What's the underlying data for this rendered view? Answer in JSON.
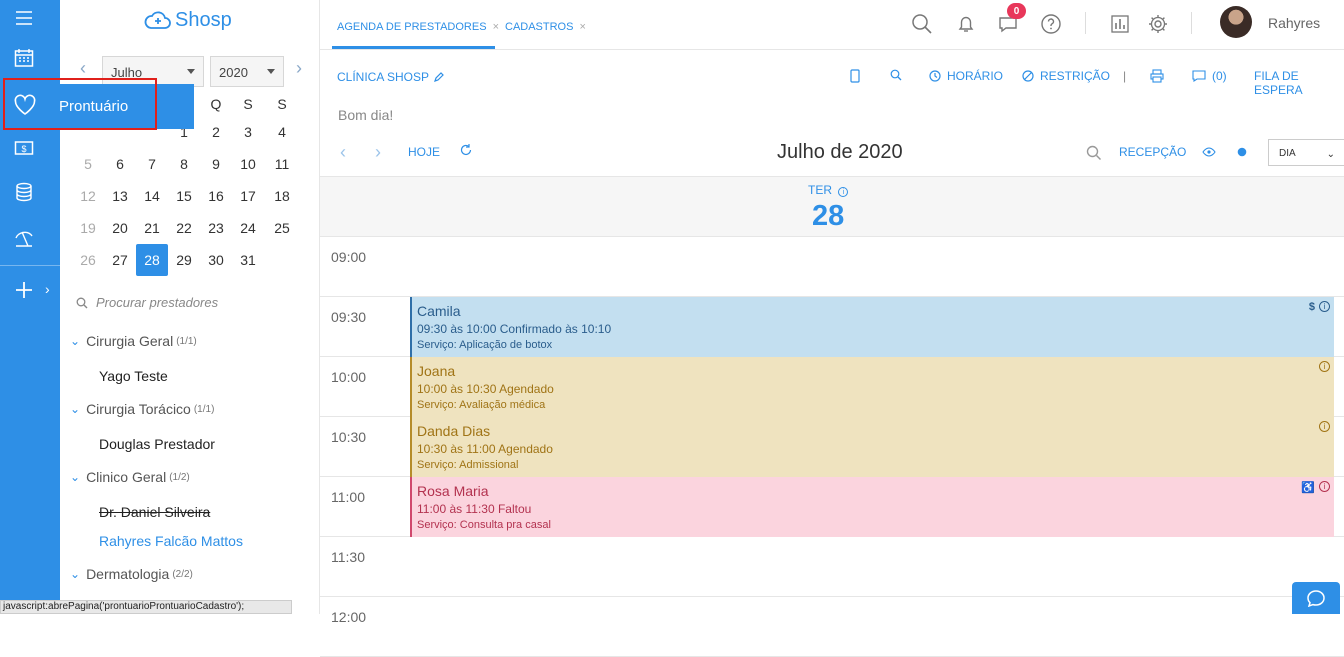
{
  "app": {
    "logo_text": "Shosp"
  },
  "tooltip": {
    "label": "Prontuário"
  },
  "calendar": {
    "month": "Julho",
    "year": "2020",
    "weekday_headers": [
      "Q",
      "S",
      "S"
    ],
    "rows": [
      [
        {
          "d": "1",
          "m": false
        },
        {
          "d": "2",
          "m": false
        },
        {
          "d": "3",
          "m": false
        },
        {
          "d": "4",
          "m": false
        }
      ],
      [
        {
          "d": "5",
          "m": true
        },
        {
          "d": "6",
          "m": false
        },
        {
          "d": "7",
          "m": false
        },
        {
          "d": "8",
          "m": false
        },
        {
          "d": "9",
          "m": false
        },
        {
          "d": "10",
          "m": false
        },
        {
          "d": "11",
          "m": false
        }
      ],
      [
        {
          "d": "12",
          "m": true
        },
        {
          "d": "13",
          "m": false
        },
        {
          "d": "14",
          "m": false
        },
        {
          "d": "15",
          "m": false
        },
        {
          "d": "16",
          "m": false
        },
        {
          "d": "17",
          "m": false
        },
        {
          "d": "18",
          "m": false
        }
      ],
      [
        {
          "d": "19",
          "m": true
        },
        {
          "d": "20",
          "m": false
        },
        {
          "d": "21",
          "m": false
        },
        {
          "d": "22",
          "m": false
        },
        {
          "d": "23",
          "m": false
        },
        {
          "d": "24",
          "m": false
        },
        {
          "d": "25",
          "m": false
        }
      ],
      [
        {
          "d": "26",
          "m": true
        },
        {
          "d": "27",
          "m": false
        },
        {
          "d": "28",
          "m": false,
          "sel": true
        },
        {
          "d": "29",
          "m": false
        },
        {
          "d": "30",
          "m": false
        },
        {
          "d": "31",
          "m": false
        }
      ]
    ]
  },
  "search_prestadores": {
    "placeholder": "Procurar prestadores"
  },
  "groups": [
    {
      "name": "Cirurgia Geral",
      "count": "(1/1)",
      "prestadores": [
        {
          "name": "Yago Teste",
          "style": "normal"
        }
      ]
    },
    {
      "name": "Cirurgia Torácico",
      "count": "(1/1)",
      "prestadores": [
        {
          "name": "Douglas Prestador",
          "style": "normal"
        }
      ]
    },
    {
      "name": "Clinico Geral",
      "count": "(1/2)",
      "prestadores": [
        {
          "name": "Dr. Daniel Silveira",
          "style": "strike"
        },
        {
          "name": "Rahyres Falcão Mattos",
          "style": "link"
        }
      ]
    },
    {
      "name": "Dermatologia",
      "count": "(2/2)",
      "prestadores": []
    }
  ],
  "status_bar": {
    "text": "javascript:abrePagina('prontuarioProntuarioCadastro');"
  },
  "tabs": [
    {
      "label": "AGENDA DE PRESTADORES",
      "active": true
    },
    {
      "label": "CADASTROS",
      "active": false
    }
  ],
  "topbar": {
    "notifications_count": "0",
    "username": "Rahyres"
  },
  "toolbar": {
    "clinic": "CLÍNICA SHOSP",
    "horario": "HORÁRIO",
    "restricao": "RESTRIÇÃO",
    "messages_count": "(0)",
    "fila": "FILA DE ESPERA"
  },
  "greeting": "Bom dia!",
  "nav": {
    "today": "HOJE",
    "title": "Julho de 2020",
    "recepcao": "RECEPÇÃO",
    "view": "DIA"
  },
  "day": {
    "name": "TER",
    "number": "28"
  },
  "hours": [
    "09:00",
    "09:30",
    "10:00",
    "10:30",
    "11:00",
    "11:30",
    "12:00"
  ],
  "appointments": [
    {
      "name": "Camila",
      "time": "09:30 às 10:00 Confirmado às 10:10",
      "service": "Serviço: Aplicação de botox",
      "bg": "#c3dff0",
      "border": "#2f6fa8",
      "color": "#2a5d8c",
      "dollar": true,
      "wheelchair": false
    },
    {
      "name": "Joana",
      "time": "10:00 às 10:30 Agendado",
      "service": "Serviço: Avaliação médica",
      "bg": "#efe3bf",
      "border": "#b58c2a",
      "color": "#a07416",
      "dollar": false,
      "wheelchair": false
    },
    {
      "name": "Danda Dias",
      "time": "10:30 às 11:00 Agendado",
      "service": "Serviço: Admissional",
      "bg": "#efe3bf",
      "border": "#b58c2a",
      "color": "#a07416",
      "dollar": false,
      "wheelchair": false
    },
    {
      "name": "Rosa Maria",
      "time": "11:00 às 11:30 Faltou",
      "service": "Serviço: Consulta pra casal",
      "bg": "#fbd4de",
      "border": "#d0486d",
      "color": "#b3324f",
      "dollar": false,
      "wheelchair": true
    }
  ],
  "colors": {
    "accent": "#2e8fe6",
    "badge": "#e8375a",
    "highlight": "#e0201b"
  }
}
